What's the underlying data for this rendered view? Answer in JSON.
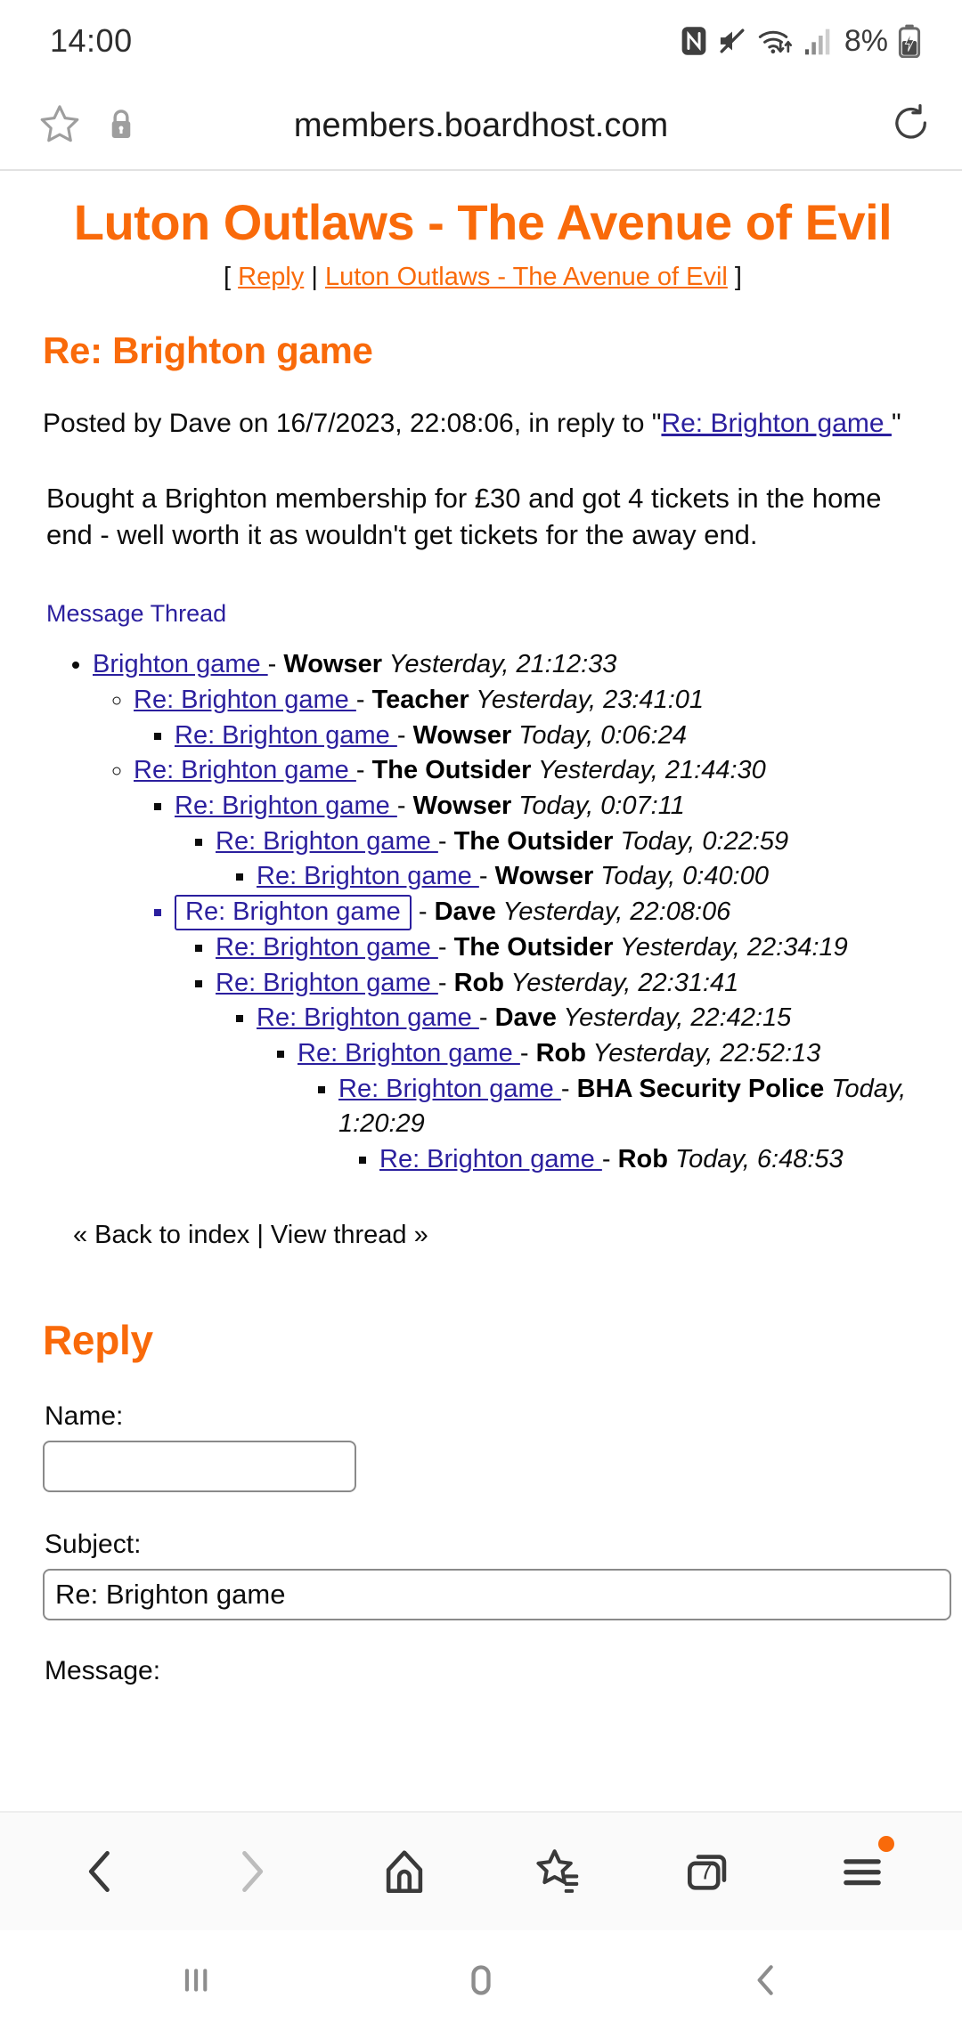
{
  "status_bar": {
    "time": "14:00",
    "battery_percent": "8%",
    "icons": [
      "nfc-icon",
      "mute-icon",
      "wifi-icon",
      "signal-icon",
      "battery-charging-icon"
    ]
  },
  "url_bar": {
    "domain": "members.boardhost.com",
    "bookmark_icon": "star-icon",
    "lock_icon": "lock-icon",
    "reload_icon": "reload-icon"
  },
  "page": {
    "board_title": "Luton Outlaws - The Avenue of Evil",
    "nav": {
      "open_bracket": "[ ",
      "reply_link": "Reply",
      "separator": " | ",
      "board_link": "Luton Outlaws - The Avenue of Evil",
      "close_bracket": " ]"
    },
    "post": {
      "subject": "Re: Brighton game",
      "meta_prefix": "Posted by Dave on 16/7/2023, 22:08:06, in reply to \"",
      "meta_link": "Re: Brighton game ",
      "meta_suffix": "\"",
      "body": "Bought a Brighton membership for £30 and got 4 tickets in the home end - well worth it as wouldn't get tickets for the away end."
    },
    "thread_label": "Message Thread",
    "thread": [
      {
        "level": 0,
        "title": "Brighton game ",
        "author": "Wowser",
        "time": "Yesterday, 21:12:33",
        "current": false
      },
      {
        "level": 1,
        "title": "Re: Brighton game ",
        "author": "Teacher",
        "time": "Yesterday, 23:41:01",
        "current": false
      },
      {
        "level": 2,
        "title": "Re: Brighton game ",
        "author": "Wowser",
        "time": "Today, 0:06:24",
        "current": false
      },
      {
        "level": 1,
        "title": "Re: Brighton game ",
        "author": "The Outsider",
        "time": "Yesterday, 21:44:30",
        "current": false
      },
      {
        "level": 2,
        "title": "Re: Brighton game ",
        "author": "Wowser",
        "time": "Today, 0:07:11",
        "current": false
      },
      {
        "level": 3,
        "title": "Re: Brighton game ",
        "author": "The Outsider",
        "time": "Today, 0:22:59",
        "current": false
      },
      {
        "level": 4,
        "title": "Re: Brighton game ",
        "author": "Wowser",
        "time": "Today, 0:40:00",
        "current": false
      },
      {
        "level": 2,
        "title": "Re: Brighton game",
        "author": "Dave",
        "time": "Yesterday, 22:08:06",
        "current": true
      },
      {
        "level": 3,
        "title": "Re: Brighton game ",
        "author": "The Outsider",
        "time": "Yesterday, 22:34:19",
        "current": false
      },
      {
        "level": 3,
        "title": "Re: Brighton game ",
        "author": "Rob",
        "time": "Yesterday, 22:31:41",
        "current": false
      },
      {
        "level": 4,
        "title": "Re: Brighton game ",
        "author": "Dave",
        "time": "Yesterday, 22:42:15",
        "current": false
      },
      {
        "level": 5,
        "title": "Re: Brighton game ",
        "author": "Rob",
        "time": "Yesterday, 22:52:13",
        "current": false
      },
      {
        "level": 6,
        "title": "Re: Brighton game ",
        "author": "BHA Security Police",
        "time": "Today, 1:20:29",
        "current": false
      },
      {
        "level": 7,
        "title": "Re: Brighton game ",
        "author": "Rob",
        "time": "Today, 6:48:53",
        "current": false
      }
    ],
    "index_links": "« Back to index | View thread »",
    "reply_form": {
      "heading": "Reply",
      "name_label": "Name:",
      "name_value": "",
      "subject_label": "Subject:",
      "subject_value": "Re: Brighton game",
      "message_label": "Message:"
    }
  },
  "browser_toolbar": {
    "back_label": "back-icon",
    "forward_label": "forward-icon",
    "home_label": "home-icon",
    "bookmarks_label": "bookmarks-icon",
    "tabs_count": "7",
    "menu_label": "menu-icon"
  },
  "nav_bar": {
    "recents_label": "recents-icon",
    "home_label": "home-icon",
    "back_label": "back-icon"
  },
  "colors": {
    "accent_orange": "#f96a0a",
    "link_blue": "#2b1f9e",
    "text": "#0c0c0c"
  }
}
